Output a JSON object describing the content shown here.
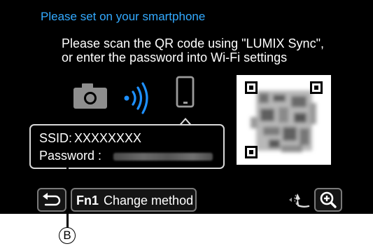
{
  "screen": {
    "heading": "Please set on your smartphone",
    "instruction_lines": [
      "Please scan the QR code using \"LUMIX Sync\",",
      "or enter the password into Wi-Fi settings"
    ]
  },
  "connection_icons": [
    "camera-icon",
    "wifi-signal-icon",
    "smartphone-icon"
  ],
  "info": {
    "ssid_label": "SSID:",
    "ssid_value": "XXXXXXXX",
    "password_label": "Password :"
  },
  "buttons": {
    "back_icon": "return-arrow-icon",
    "change_fn_label": "Fn1",
    "change_label": "Change method",
    "zoom_icon": "zoom-in-icon",
    "dial_icon": "control-dial-icon"
  },
  "callout": {
    "label": "B"
  },
  "colors": {
    "heading": "#33aaff",
    "background": "#000000",
    "text": "#ffffff"
  }
}
